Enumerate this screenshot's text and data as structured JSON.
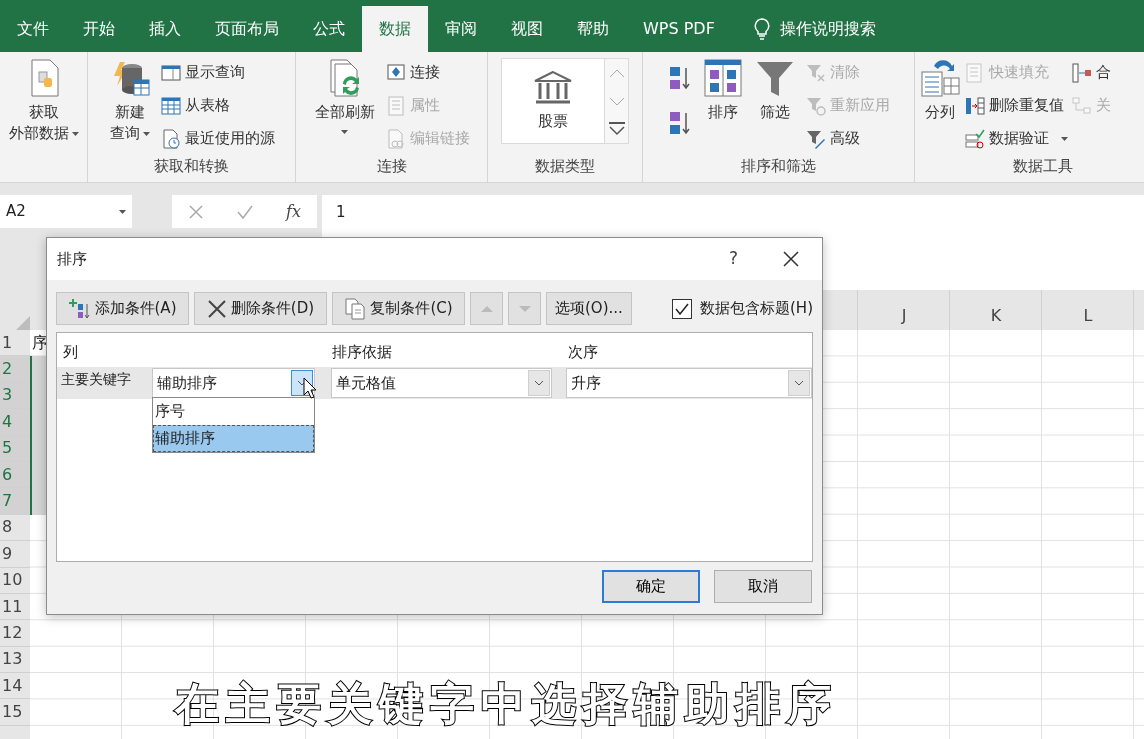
{
  "ribbon_tabs": [
    {
      "label": "文件",
      "selected": false
    },
    {
      "label": "开始",
      "selected": false
    },
    {
      "label": "插入",
      "selected": false
    },
    {
      "label": "页面布局",
      "selected": false
    },
    {
      "label": "公式",
      "selected": false
    },
    {
      "label": "数据",
      "selected": true
    },
    {
      "label": "审阅",
      "selected": false
    },
    {
      "label": "视图",
      "selected": false
    },
    {
      "label": "帮助",
      "selected": false
    },
    {
      "label": "WPS PDF",
      "selected": false
    }
  ],
  "tell_me": {
    "label": "操作说明搜索"
  },
  "ribbon_groups": [
    {
      "items": [
        {
          "kind": "large",
          "lines": [
            "获取",
            "外部数据"
          ],
          "dropdown": true
        }
      ]
    },
    {
      "label": "获取和转换",
      "items": [
        {
          "kind": "large",
          "lines": [
            "新建",
            "查询"
          ],
          "dropdown": true
        },
        {
          "kind": "small",
          "label": "显示查询",
          "disabled": false
        },
        {
          "kind": "small",
          "label": "从表格",
          "disabled": false
        },
        {
          "kind": "small",
          "label": "最近使用的源",
          "disabled": false
        }
      ]
    },
    {
      "label": "连接",
      "items": [
        {
          "kind": "large",
          "lines": [
            "全部刷新"
          ],
          "dropdown": true
        },
        {
          "kind": "small",
          "label": "连接",
          "disabled": false
        },
        {
          "kind": "small",
          "label": "属性",
          "disabled": true
        },
        {
          "kind": "small",
          "label": "编辑链接",
          "disabled": true
        }
      ]
    },
    {
      "label": "数据类型",
      "items": [
        {
          "kind": "gallery",
          "label": "股票"
        }
      ]
    },
    {
      "label": "排序和筛选",
      "items": [
        {
          "kind": "icon"
        },
        {
          "kind": "icon"
        },
        {
          "kind": "large",
          "lines": [
            "排序"
          ]
        },
        {
          "kind": "large",
          "lines": [
            "筛选"
          ]
        },
        {
          "kind": "small",
          "label": "清除",
          "disabled": true
        },
        {
          "kind": "small",
          "label": "重新应用",
          "disabled": true
        },
        {
          "kind": "small",
          "label": "高级",
          "disabled": false
        }
      ]
    },
    {
      "label": "数据工具",
      "items": [
        {
          "kind": "large",
          "lines": [
            "分列"
          ]
        },
        {
          "kind": "small",
          "label": "快速填充",
          "disabled": true
        },
        {
          "kind": "small",
          "label": "删除重复值",
          "disabled": false
        },
        {
          "kind": "small",
          "label": "数据验证",
          "disabled": false,
          "dropdown": true
        },
        {
          "kind": "small",
          "label": "合",
          "disabled": false
        },
        {
          "kind": "small",
          "label": "关",
          "disabled": true
        }
      ]
    }
  ],
  "formula_bar": {
    "name_box": "A2",
    "function_button": "fx",
    "formula": "1"
  },
  "sheet": {
    "columns": [
      {
        "label": "J"
      },
      {
        "label": "K"
      },
      {
        "label": "L"
      }
    ],
    "rows": [
      {
        "label": "1",
        "selected": false,
        "cell_a": "序"
      },
      {
        "label": "2",
        "selected": true
      },
      {
        "label": "3",
        "selected": true
      },
      {
        "label": "4",
        "selected": true
      },
      {
        "label": "5",
        "selected": true
      },
      {
        "label": "6",
        "selected": true
      },
      {
        "label": "7",
        "selected": true
      },
      {
        "label": "8",
        "selected": false
      },
      {
        "label": "9",
        "selected": false
      },
      {
        "label": "10",
        "selected": false
      },
      {
        "label": "11",
        "selected": false
      },
      {
        "label": "12",
        "selected": false
      },
      {
        "label": "13",
        "selected": false
      },
      {
        "label": "14",
        "selected": false
      },
      {
        "label": "15",
        "selected": false
      }
    ]
  },
  "sort_dialog": {
    "title": "排序",
    "help": "?",
    "toolbar": [
      {
        "label": "添加条件(A)",
        "disabled": false
      },
      {
        "label": "删除条件(D)",
        "disabled": false
      },
      {
        "label": "复制条件(C)",
        "disabled": false
      }
    ],
    "move_up": {
      "disabled": true
    },
    "move_down": {
      "disabled": true
    },
    "options_button": "选项(O)...",
    "has_headers": {
      "label": "数据包含标题(H)",
      "checked": true
    },
    "columns": [
      "列",
      "排序依据",
      "次序"
    ],
    "levels": [
      {
        "label": "主要关键字",
        "column": "辅助排序",
        "sort_on": "单元格值",
        "order": "升序",
        "expanded": true
      }
    ],
    "column_options": [
      {
        "label": "序号",
        "selected": false
      },
      {
        "label": "辅助排序",
        "selected": true
      }
    ],
    "buttons": [
      {
        "label": "确定",
        "default": true
      },
      {
        "label": "取消",
        "default": false
      }
    ]
  },
  "subtitle": "在主要关键字中选择辅助排序"
}
